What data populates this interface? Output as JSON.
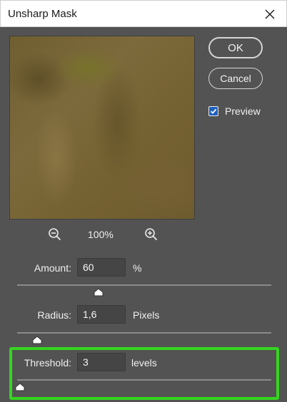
{
  "window": {
    "title": "Unsharp Mask",
    "close_icon": "close-icon"
  },
  "buttons": {
    "ok_label": "OK",
    "cancel_label": "Cancel"
  },
  "preview_toggle": {
    "label": "Preview",
    "checked": true
  },
  "zoom": {
    "level": "100%",
    "zoom_out_icon": "zoom-out-icon",
    "zoom_in_icon": "zoom-in-icon"
  },
  "params": {
    "amount": {
      "label": "Amount:",
      "value": "60",
      "unit": "%",
      "slider_fraction": 0.32
    },
    "radius": {
      "label": "Radius:",
      "value": "1,6",
      "unit": "Pixels",
      "slider_fraction": 0.08
    },
    "threshold": {
      "label": "Threshold:",
      "value": "3",
      "unit": "levels",
      "slider_fraction": 0.012
    }
  },
  "colors": {
    "dialog_bg": "#535353",
    "highlight": "#35d51f"
  }
}
